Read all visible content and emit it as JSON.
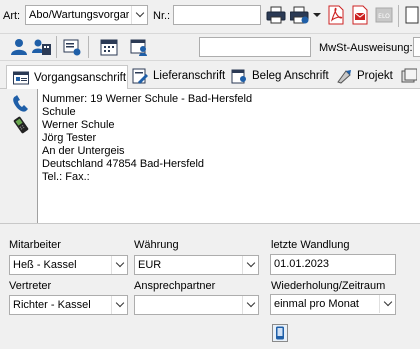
{
  "toolbar": {
    "art_label": "Art:",
    "art_value": "Abo/Wartungsvorgar",
    "nr_label": "Nr.:",
    "nr_value": ""
  },
  "toolbar2": {
    "mwst_label": "MwSt-Ausweisung:",
    "field_value": ""
  },
  "tabs": [
    {
      "label": "Vorgangsanschrift",
      "icon": "address-card-icon"
    },
    {
      "label": "Lieferanschrift",
      "icon": "delivery-icon"
    },
    {
      "label": "Beleg Anschrift",
      "icon": "document-address-icon"
    },
    {
      "label": "Projekt",
      "icon": "project-icon"
    }
  ],
  "address": {
    "lines": [
      "Nummer: 19  Werner Schule - Bad-Hersfeld",
      "Schule",
      "Werner Schule",
      "Jörg Tester",
      "An der Untergeis",
      "Deutschland 47854 Bad-Hersfeld",
      "Tel.:   Fax.:"
    ]
  },
  "form": {
    "mitarbeiter_label": "Mitarbeiter",
    "mitarbeiter_value": "Heß - Kassel",
    "waehrung_label": "Währung",
    "waehrung_value": "EUR",
    "wandlung_label": "letzte Wandlung",
    "wandlung_value": "01.01.2023",
    "vertreter_label": "Vertreter",
    "vertreter_value": "Richter - Kassel",
    "ansprechpartner_label": "Ansprechpartner",
    "ansprechpartner_value": "",
    "wiederholung_label": "Wiederholung/Zeitraum",
    "wiederholung_value": "einmal pro Monat"
  },
  "colors": {
    "accent_blue": "#1f5fa8",
    "pdf_red": "#cc2222"
  }
}
